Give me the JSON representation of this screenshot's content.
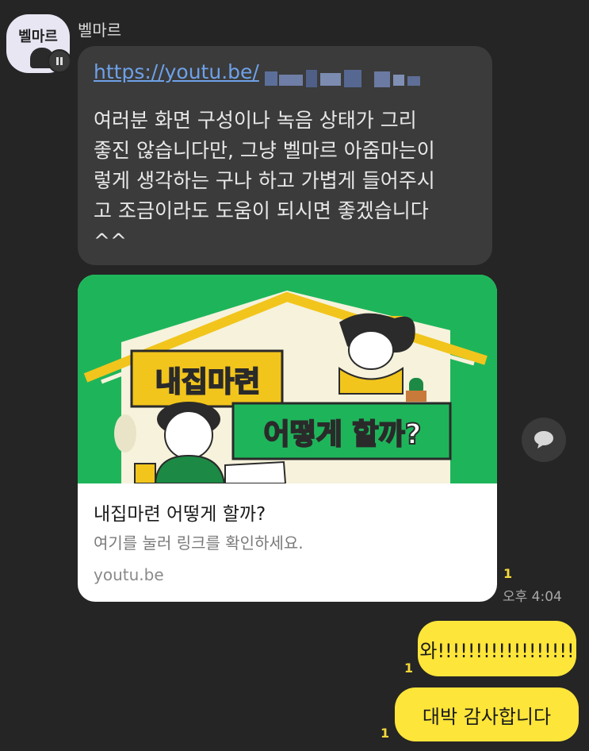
{
  "chat": {
    "sender": {
      "name": "벨마르",
      "avatar_text": "벨마르"
    },
    "incoming": {
      "link_url": "https://youtu.be/",
      "text": "여러분 화면 구성이나 녹음 상태가 그리\n좋진 않습니다만, 그냥 벨마르 아줌마는이\n렇게 생각하는 구나 하고 가볍게 들어주시\n고 조금이라도 도움이 되시면 좋겠습니다\n^^",
      "preview": {
        "thumbnail_caption_1": "내집마련",
        "thumbnail_caption_2": "어떻게 할까?",
        "title": "내집마련 어떻게 할까?",
        "subtitle": "여기를 눌러 링크를 확인하세요.",
        "domain": "youtu.be"
      },
      "unread": "1",
      "time": "오후 4:04"
    },
    "outgoing": [
      {
        "text": "와!!!!!!!!!!!!!!!!!!",
        "unread": "1"
      },
      {
        "text": "대박 감사합니다",
        "unread": "1"
      }
    ]
  },
  "icons": {
    "share": "share-icon",
    "avatar_badge": "profile-badge-icon"
  },
  "colors": {
    "background": "#252525",
    "incoming_bubble": "#3b3b3b",
    "outgoing_bubble": "#fde53a",
    "link": "#6ea1e8",
    "thumbnail_green": "#1eb55a",
    "unread_count": "#f5d83a"
  }
}
